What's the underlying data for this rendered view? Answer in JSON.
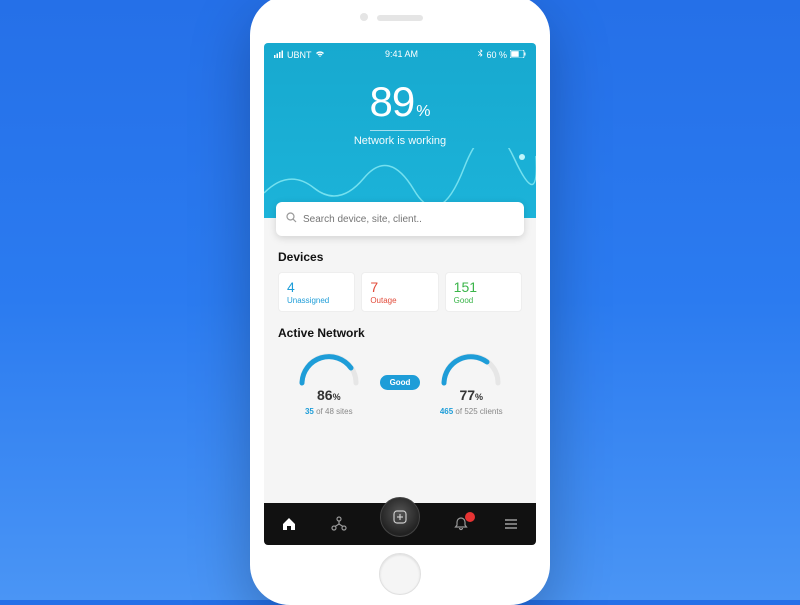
{
  "status_bar": {
    "carrier": "UBNT",
    "time": "9:41 AM",
    "battery_pct": "60 %"
  },
  "hero": {
    "percent": "89",
    "percent_symbol": "%",
    "status": "Network is working"
  },
  "search": {
    "placeholder": "Search device, site, client.."
  },
  "devices": {
    "title": "Devices",
    "cards": [
      {
        "count": "4",
        "label": "Unassigned",
        "color": "blue"
      },
      {
        "count": "7",
        "label": "Outage",
        "color": "red"
      },
      {
        "count": "151",
        "label": "Good",
        "color": "green"
      }
    ]
  },
  "active_network": {
    "title": "Active Network",
    "pill": "Good",
    "gauges": [
      {
        "percent": "86",
        "hl": "35",
        "of": "48",
        "unit": "sites",
        "fill": 0.86
      },
      {
        "percent": "77",
        "hl": "465",
        "of": "525",
        "unit": "clients",
        "fill": 0.77
      }
    ]
  },
  "tabbar": {
    "notification_has_badge": true
  },
  "colors": {
    "accent": "#1e9dd8",
    "danger": "#e24b3a",
    "success": "#3bb54a",
    "header_bg": "#17a9cf"
  }
}
